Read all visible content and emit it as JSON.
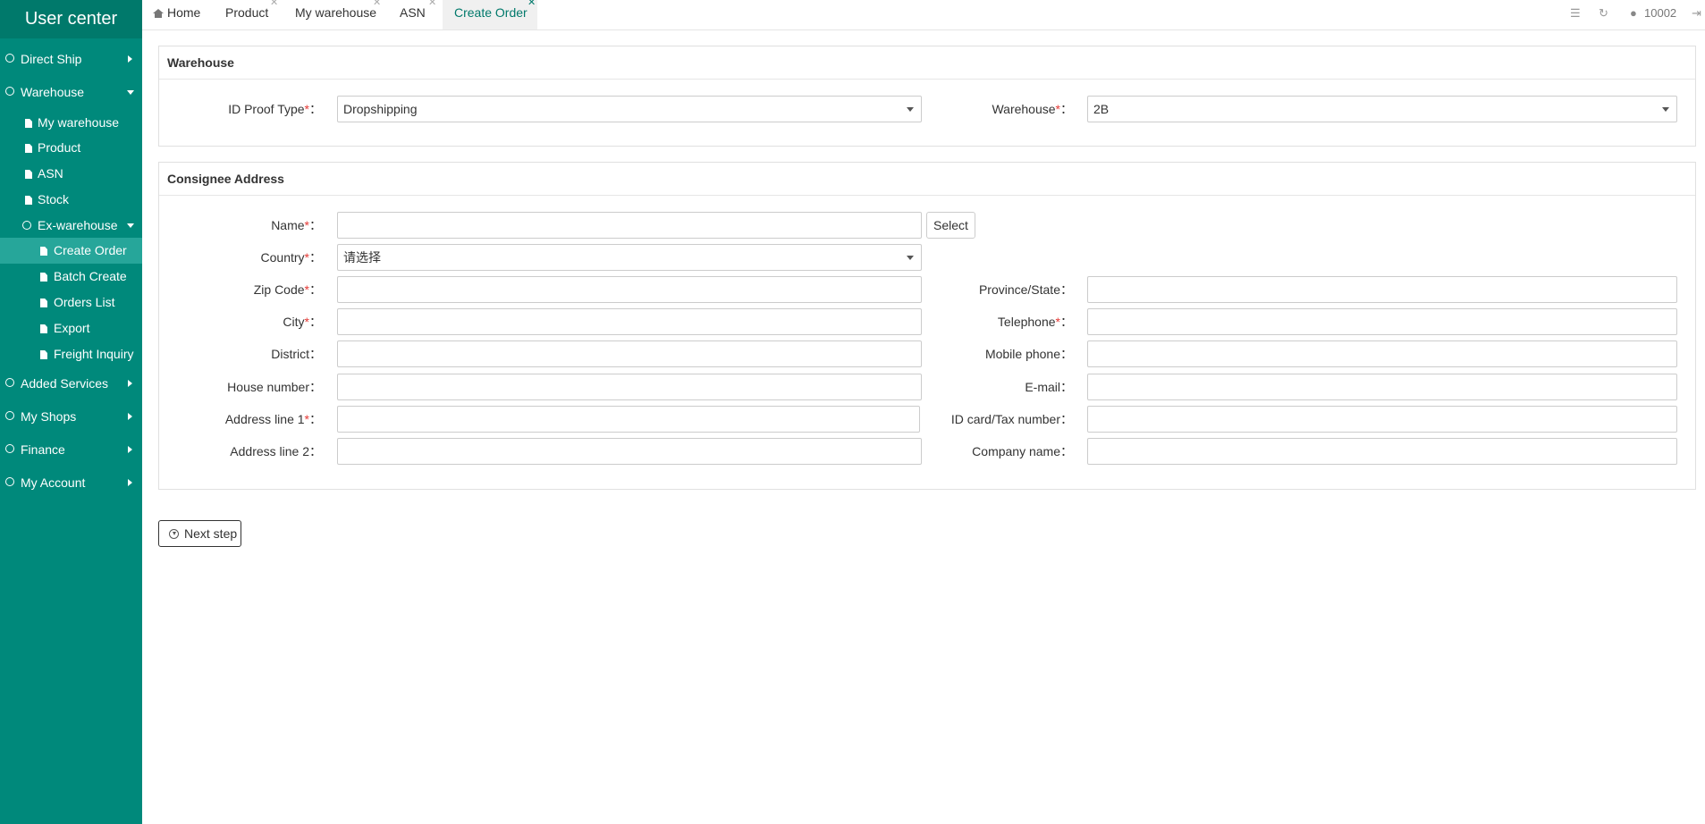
{
  "sidebar": {
    "brand": "User center",
    "top_items": [
      {
        "label": "Direct Ship"
      },
      {
        "label": "Warehouse"
      },
      {
        "label": "Added Services"
      },
      {
        "label": "My Shops"
      },
      {
        "label": "Finance"
      },
      {
        "label": "My Account"
      }
    ],
    "warehouse_items": [
      {
        "label": "My warehouse"
      },
      {
        "label": "Product"
      },
      {
        "label": "ASN"
      },
      {
        "label": "Stock"
      },
      {
        "label": "Ex-warehouse"
      }
    ],
    "ex_warehouse_items": [
      {
        "label": "Create Order"
      },
      {
        "label": "Batch Create"
      },
      {
        "label": "Orders List"
      },
      {
        "label": "Export"
      },
      {
        "label": "Freight Inquiry"
      }
    ]
  },
  "tabs": [
    {
      "label": "Home"
    },
    {
      "label": "Product"
    },
    {
      "label": "My warehouse"
    },
    {
      "label": "ASN"
    },
    {
      "label": "Create Order"
    }
  ],
  "topbar": {
    "user_id": "10002"
  },
  "warehouse_panel": {
    "title": "Warehouse",
    "id_proof_label": "ID Proof Type",
    "id_proof_value": "Dropshipping",
    "warehouse_label": "Warehouse",
    "warehouse_value": "2B"
  },
  "consignee_panel": {
    "title": "Consignee Address",
    "name_label": "Name",
    "select_button": "Select",
    "country_label": "Country",
    "country_value": "请选择",
    "zip_label": "Zip Code",
    "province_label": "Province/State",
    "city_label": "City",
    "telephone_label": "Telephone",
    "district_label": "District",
    "mobile_label": "Mobile phone",
    "house_label": "House number",
    "email_label": "E-mail",
    "address1_label": "Address line 1",
    "idcard_label": "ID card/Tax number",
    "address2_label": "Address line 2",
    "company_label": "Company name",
    "required_mark": "*",
    "colon": "："
  },
  "actions": {
    "next_step": "Next step"
  },
  "colors": {
    "sidebar": "#00897b",
    "brand": "#00796b",
    "active_item": "#26a69a",
    "required": "#e53935"
  }
}
